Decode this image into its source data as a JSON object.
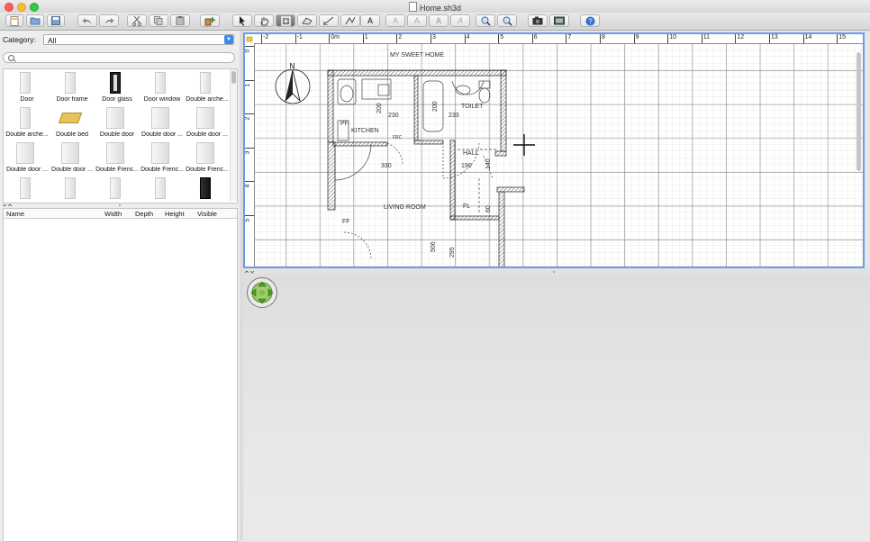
{
  "window": {
    "title": "Home.sh3d"
  },
  "toolbar": {
    "buttons": [
      "new-icon",
      "open-icon",
      "save-icon",
      "undo-icon",
      "redo-icon",
      "cut-icon",
      "copy-icon",
      "paste-icon",
      "add-furniture-icon",
      "select-icon",
      "pan-icon",
      "create-walls-icon",
      "create-rooms-icon",
      "create-dimensions-icon",
      "create-polylines-icon",
      "add-text-icon",
      "text-style-1-icon",
      "text-style-2-icon",
      "text-style-3-icon",
      "text-style-4-icon",
      "zoom-in-icon",
      "zoom-out-icon",
      "photo-icon",
      "video-icon",
      "help-icon"
    ],
    "active": "create-walls-icon"
  },
  "catalog": {
    "category_label": "Category:",
    "category_value": "All",
    "search_placeholder": "",
    "items": [
      {
        "label": "Door",
        "kind": "door"
      },
      {
        "label": "Door frame",
        "kind": "frame"
      },
      {
        "label": "Door glass",
        "kind": "dark"
      },
      {
        "label": "Door window",
        "kind": "door"
      },
      {
        "label": "Double arche...",
        "kind": "door"
      },
      {
        "label": "Double arche...",
        "kind": "door"
      },
      {
        "label": "Double bed",
        "kind": "bed"
      },
      {
        "label": "Double door",
        "kind": "wide"
      },
      {
        "label": "Double door ...",
        "kind": "wide"
      },
      {
        "label": "Double door ...",
        "kind": "wide"
      },
      {
        "label": "Double door ...",
        "kind": "wide"
      },
      {
        "label": "Double door ...",
        "kind": "wide"
      },
      {
        "label": "Double Frenc...",
        "kind": "wide"
      },
      {
        "label": "Double Frenc...",
        "kind": "wide"
      },
      {
        "label": "Double Frenc...",
        "kind": "wide"
      },
      {
        "label": "",
        "kind": "door"
      },
      {
        "label": "",
        "kind": "door"
      },
      {
        "label": "",
        "kind": "door"
      },
      {
        "label": "",
        "kind": "door"
      },
      {
        "label": "",
        "kind": "fridge"
      }
    ]
  },
  "furniture_table": {
    "columns": [
      "Name",
      "Width",
      "Depth",
      "Height",
      "Visible"
    ]
  },
  "plan": {
    "ruler_top": [
      "-2",
      "-1",
      "0m",
      "1",
      "2",
      "3",
      "4",
      "5",
      "6",
      "7",
      "8",
      "9",
      "10",
      "11",
      "12",
      "13",
      "14",
      "15"
    ],
    "ruler_left": [
      "0",
      "1",
      "2",
      "3",
      "4",
      "5"
    ],
    "labels": {
      "title": "MY SWEET HOME",
      "toilet": "TOILET",
      "kitchen": "KITCHEN",
      "hall": "HALL",
      "living": "LIVING ROOM",
      "pf": "PF",
      "fl": "FL",
      "ff": "FF",
      "ff_small": "FRC",
      "d230": "230",
      "d233": "233",
      "d200a": "200",
      "d200b": "200",
      "d330": "330",
      "d190": "190",
      "d140": "140",
      "d60": "60",
      "d506": "506",
      "d295": "295"
    },
    "compass_letter": "N"
  }
}
